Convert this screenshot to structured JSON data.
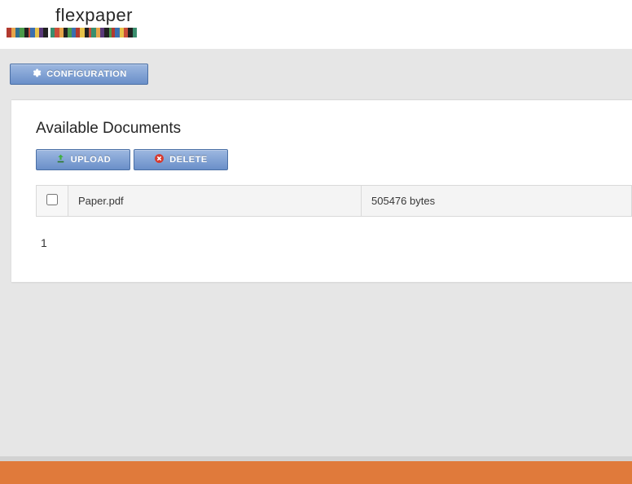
{
  "brand": {
    "name": "flexpaper"
  },
  "nav": {
    "configuration_label": "CONFIGURATION"
  },
  "main": {
    "heading": "Available Documents",
    "upload_label": "UPLOAD",
    "delete_label": "DELETE",
    "documents": [
      {
        "name": "Paper.pdf",
        "size": "505476 bytes"
      }
    ],
    "pagination": "1"
  },
  "barcode_colors": [
    "#b23a2f",
    "#e6a54a",
    "#2f6e8e",
    "#4a9a4a",
    "#222",
    "#c94d3a",
    "#3a6fb0",
    "#e6c24a",
    "#5a3a7a",
    "#222",
    "#fff",
    "#3a8e6e",
    "#c94d3a",
    "#e6a54a",
    "#222",
    "#4a9a4a",
    "#3a6fb0",
    "#b23a2f",
    "#e6c24a",
    "#222",
    "#c94d3a",
    "#3a8e6e",
    "#e6a54a",
    "#5a3a7a",
    "#222",
    "#4a9a4a",
    "#b23a2f",
    "#3a6fb0",
    "#e6c24a",
    "#c94d3a",
    "#222",
    "#3a8e6e"
  ]
}
